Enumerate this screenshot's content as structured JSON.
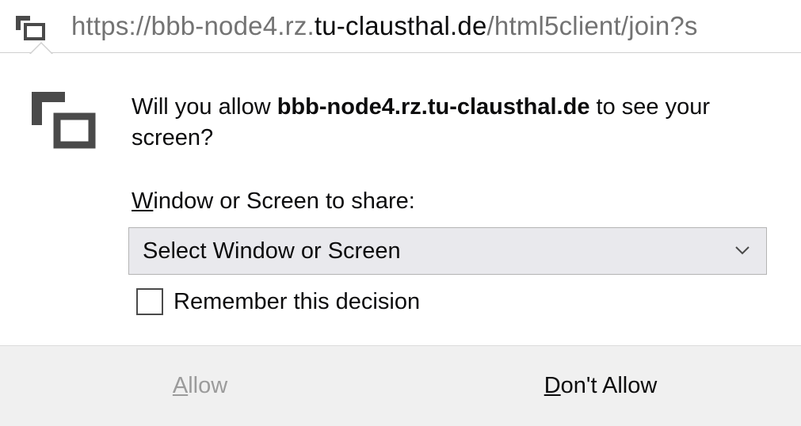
{
  "urlbar": {
    "icon": "screen-share-icon",
    "prefix": "https://bbb-node4.rz.",
    "domain": "tu-clausthal.de",
    "suffix": "/html5client/join?s"
  },
  "prompt": {
    "icon": "screen-share-icon",
    "message_before": "Will you allow ",
    "message_host": "bbb-node4.rz.tu-clausthal.de",
    "message_after": " to see your screen?",
    "share_label_accesskey": "W",
    "share_label_rest": "indow or Screen to share:",
    "select_value": "Select Window or Screen",
    "select_icon": "chevron-down-icon",
    "remember_label": "Remember this decision",
    "remember_checked": false
  },
  "buttons": {
    "allow_accesskey": "A",
    "allow_rest": "llow",
    "allow_enabled": false,
    "deny_accesskey": "D",
    "deny_rest": "on't Allow"
  },
  "colors": {
    "text": "#0c0c0d",
    "url_gray": "#737373",
    "disabled": "#9b9b9b",
    "footer_bg": "#f0f0f0",
    "select_bg": "#e9e9ed"
  }
}
